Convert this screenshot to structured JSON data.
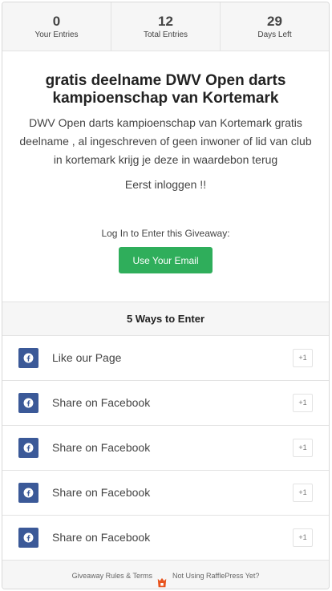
{
  "stats": [
    {
      "value": "0",
      "label": "Your Entries"
    },
    {
      "value": "12",
      "label": "Total Entries"
    },
    {
      "value": "29",
      "label": "Days Left"
    }
  ],
  "giveaway": {
    "title": "gratis deelname DWV Open darts kampioenschap van Kortemark",
    "description": "DWV Open darts kampioenschap van Kortemark gratis deelname , al ingeschreven of geen inwoner of lid van club in kortemark krijg je deze in waardebon terug",
    "note": "Eerst inloggen !!",
    "login_prompt": "Log In to Enter this Giveaway:",
    "email_button": "Use Your Email"
  },
  "ways": {
    "header": "5 Ways to Enter",
    "items": [
      {
        "label": "Like our Page",
        "points": "+1",
        "icon": "facebook-icon"
      },
      {
        "label": "Share on Facebook",
        "points": "+1",
        "icon": "facebook-icon"
      },
      {
        "label": "Share on Facebook",
        "points": "+1",
        "icon": "facebook-icon"
      },
      {
        "label": "Share on Facebook",
        "points": "+1",
        "icon": "facebook-icon"
      },
      {
        "label": "Share on Facebook",
        "points": "+1",
        "icon": "facebook-icon"
      }
    ]
  },
  "footer": {
    "rules_link": "Giveaway Rules & Terms",
    "promo_link": "Not Using RafflePress Yet?",
    "logo_icon": "rafflepress-logo-icon"
  },
  "colors": {
    "button_green": "#2fae5b",
    "facebook_blue": "#3b5998",
    "logo_orange": "#e8541e"
  }
}
